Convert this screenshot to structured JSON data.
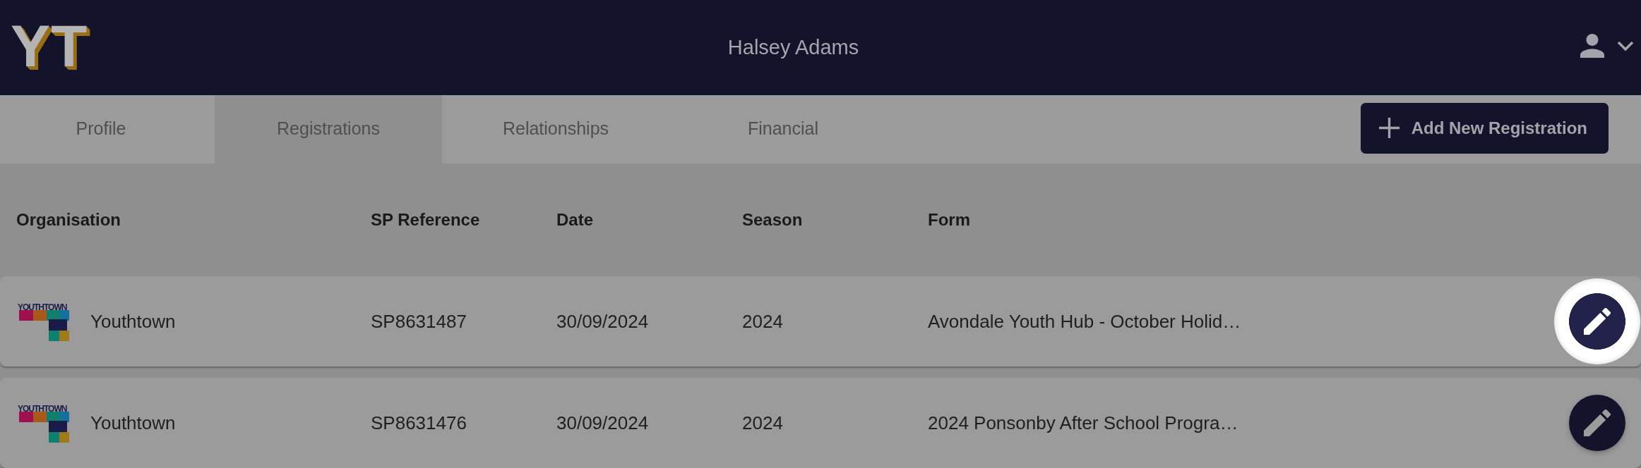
{
  "header": {
    "logo": "YT",
    "title": "Halsey Adams"
  },
  "tabs": [
    {
      "label": "Profile",
      "selected": false
    },
    {
      "label": "Registrations",
      "selected": true
    },
    {
      "label": "Relationships",
      "selected": false
    },
    {
      "label": "Financial",
      "selected": false
    }
  ],
  "add_button": {
    "label": "Add New Registration"
  },
  "table": {
    "columns": [
      "Organisation",
      "SP Reference",
      "Date",
      "Season",
      "Form"
    ],
    "rows": [
      {
        "organisation": {
          "logo": "YOUTHTOWN",
          "name": "Youthtown"
        },
        "sp_reference": "SP8631487",
        "date": "30/09/2024",
        "season": "2024",
        "form": "Avondale Youth Hub - October Holid…",
        "edit": {
          "highlighted": true
        }
      },
      {
        "organisation": {
          "logo": "YOUTHTOWN",
          "name": "Youthtown"
        },
        "sp_reference": "SP8631476",
        "date": "30/09/2024",
        "season": "2024",
        "form": "2024 Ponsonby After School Progra…",
        "edit": {
          "highlighted": false
        }
      }
    ]
  }
}
